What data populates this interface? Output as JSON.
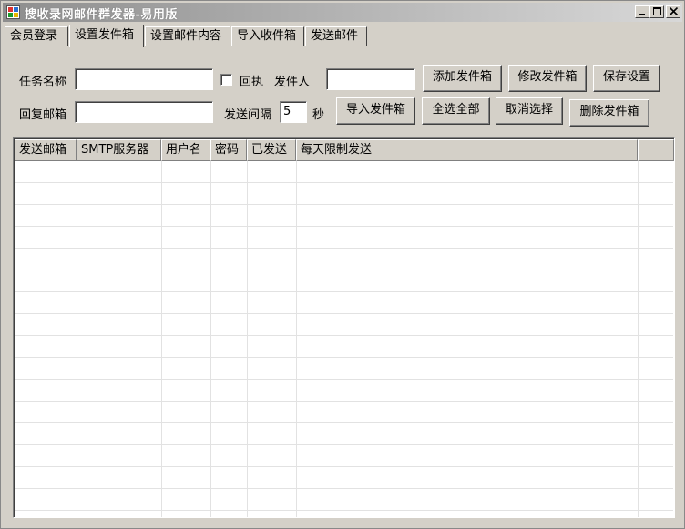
{
  "window": {
    "title": "搜收录网邮件群发器-易用版"
  },
  "tabs": [
    "会员登录",
    "设置发件箱",
    "设置邮件内容",
    "导入收件箱",
    "发送邮件"
  ],
  "active_tab": "设置发件箱",
  "form": {
    "task_name_label": "任务名称",
    "task_name_value": "",
    "receipt_label": "回执",
    "receipt_checked": false,
    "sender_label": "发件人",
    "sender_value": "",
    "reply_label": "回复邮箱",
    "reply_value": "",
    "interval_label": "发送间隔",
    "interval_value": "5",
    "interval_unit": "秒"
  },
  "buttons": {
    "add": "添加发件箱",
    "modify": "修改发件箱",
    "save": "保存设置",
    "import": "导入发件箱",
    "select_all": "全选全部",
    "deselect": "取消选择",
    "delete": "删除发件箱"
  },
  "table": {
    "columns": [
      "发送邮箱",
      "SMTP服务器",
      "用户名",
      "密码",
      "已发送",
      "每天限制发送"
    ],
    "rows": []
  }
}
